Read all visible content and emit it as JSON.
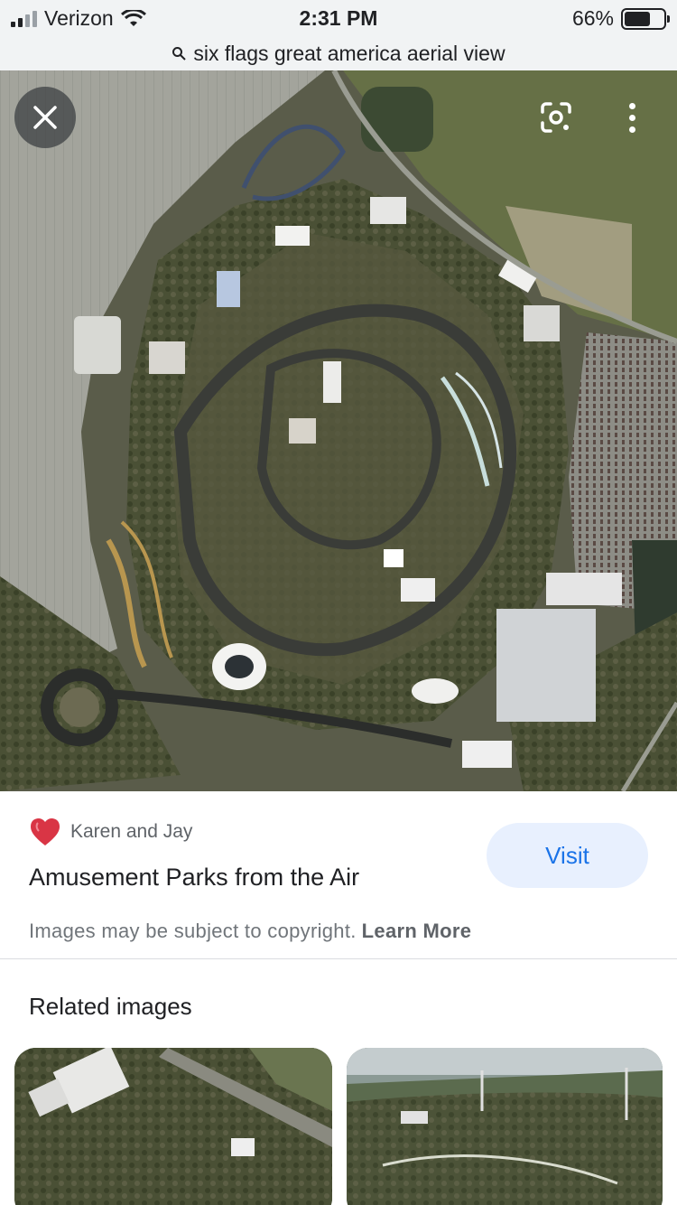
{
  "status_bar": {
    "carrier": "Verizon",
    "time": "2:31 PM",
    "battery_percent": "66%",
    "battery_level": 0.66,
    "icons": [
      "signal-icon",
      "wifi-icon",
      "battery-icon"
    ]
  },
  "search": {
    "query": "six flags great america aerial view",
    "icon": "search-icon"
  },
  "viewer": {
    "close_icon": "close-icon",
    "lens_icon": "lens-icon",
    "more_icon": "more-vert-icon"
  },
  "result": {
    "source_name": "Karen and Jay",
    "source_icon": "heart-favicon-icon",
    "title": "Amusement Parks from the Air",
    "visit_label": "Visit",
    "copyright_text": "Images may be subject to copyright.",
    "learn_more_label": "Learn More"
  },
  "related": {
    "heading": "Related images"
  },
  "colors": {
    "accent": "#1a73e8",
    "visit_bg": "#e8f0fe",
    "bar_bg": "#f1f3f4"
  }
}
